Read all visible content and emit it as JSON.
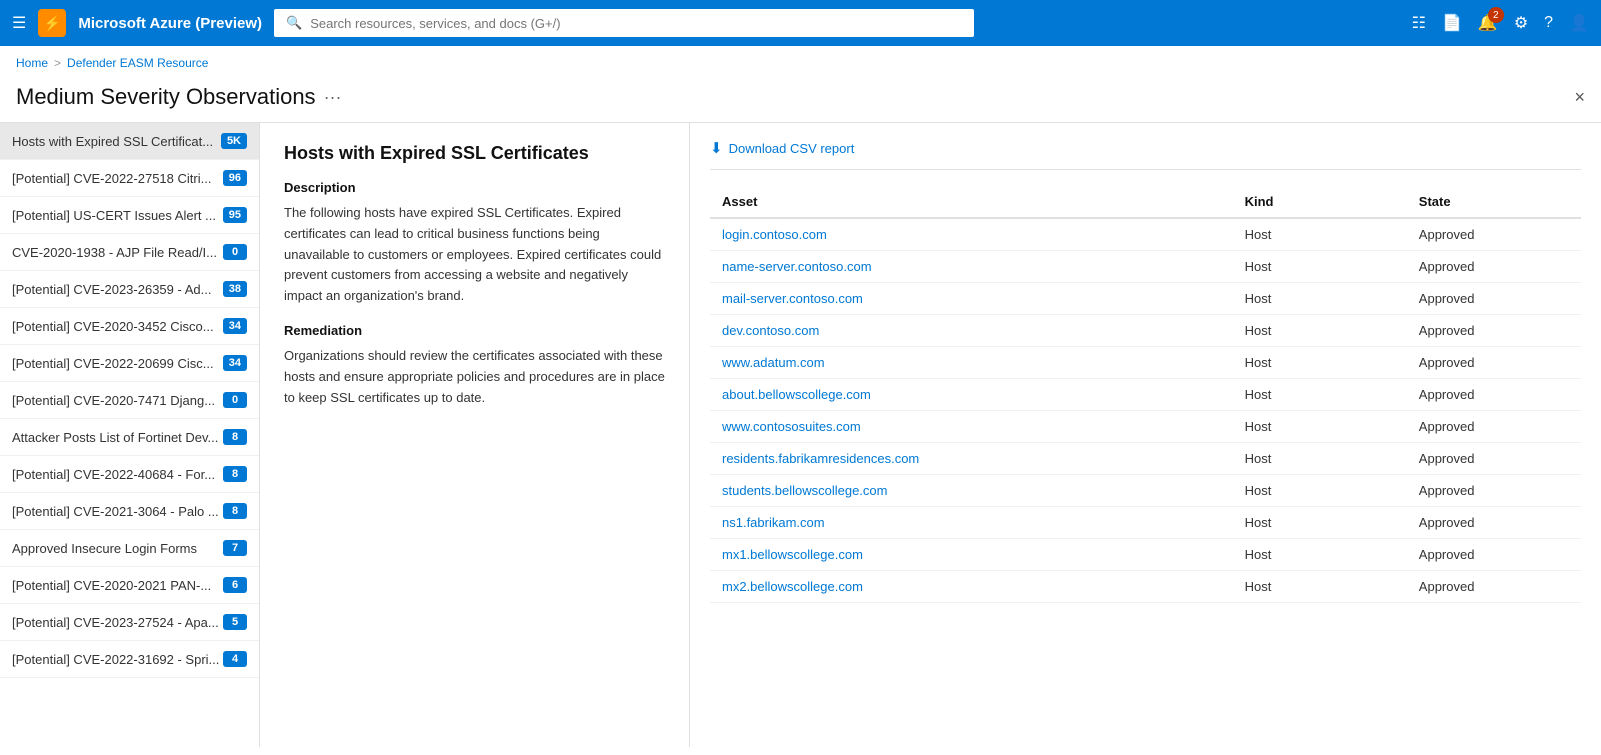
{
  "nav": {
    "brand": "Microsoft Azure (Preview)",
    "logo_char": "⚡",
    "search_placeholder": "Search resources, services, and docs (G+/)",
    "notification_count": "2",
    "icons": [
      "grid-icon",
      "portal-icon",
      "bell-icon",
      "gear-icon",
      "help-icon",
      "user-icon"
    ]
  },
  "breadcrumb": {
    "items": [
      "Home",
      "Defender EASM Resource"
    ]
  },
  "page": {
    "title": "Medium Severity Observations",
    "close_label": "×"
  },
  "sidebar": {
    "items": [
      {
        "label": "Hosts with Expired SSL Certificat...",
        "badge": "5K",
        "active": true
      },
      {
        "label": "[Potential] CVE-2022-27518 Citri...",
        "badge": "96"
      },
      {
        "label": "[Potential] US-CERT Issues Alert ...",
        "badge": "95"
      },
      {
        "label": "CVE-2020-1938 - AJP File Read/I...",
        "badge": "0"
      },
      {
        "label": "[Potential] CVE-2023-26359 - Ad...",
        "badge": "38"
      },
      {
        "label": "[Potential] CVE-2020-3452 Cisco...",
        "badge": "34"
      },
      {
        "label": "[Potential] CVE-2022-20699 Cisc...",
        "badge": "34"
      },
      {
        "label": "[Potential] CVE-2020-7471 Djang...",
        "badge": "0"
      },
      {
        "label": "Attacker Posts List of Fortinet Dev...",
        "badge": "8"
      },
      {
        "label": "[Potential] CVE-2022-40684 - For...",
        "badge": "8"
      },
      {
        "label": "[Potential] CVE-2021-3064 - Palo ...",
        "badge": "8"
      },
      {
        "label": "Approved Insecure Login Forms",
        "badge": "7"
      },
      {
        "label": "[Potential] CVE-2020-2021 PAN-...",
        "badge": "6"
      },
      {
        "label": "[Potential] CVE-2023-27524 - Apa...",
        "badge": "5"
      },
      {
        "label": "[Potential] CVE-2022-31692 - Spri...",
        "badge": "4"
      }
    ]
  },
  "detail": {
    "title": "Hosts with Expired SSL Certificates",
    "description_label": "Description",
    "description": "The following hosts have expired SSL Certificates. Expired certificates can lead to critical business functions being unavailable to customers or employees. Expired certificates could prevent customers from accessing a website and negatively impact an organization's brand.",
    "remediation_label": "Remediation",
    "remediation": "Organizations should review the certificates associated with these hosts and ensure appropriate policies and procedures are in place to keep SSL certificates up to date."
  },
  "table": {
    "csv_label": "Download CSV report",
    "columns": [
      "Asset",
      "Kind",
      "State"
    ],
    "rows": [
      {
        "asset": "login.contoso.com",
        "kind": "Host",
        "state": "Approved"
      },
      {
        "asset": "name-server.contoso.com",
        "kind": "Host",
        "state": "Approved"
      },
      {
        "asset": "mail-server.contoso.com",
        "kind": "Host",
        "state": "Approved"
      },
      {
        "asset": "dev.contoso.com",
        "kind": "Host",
        "state": "Approved"
      },
      {
        "asset": "www.adatum.com",
        "kind": "Host",
        "state": "Approved"
      },
      {
        "asset": "about.bellowscollege.com",
        "kind": "Host",
        "state": "Approved"
      },
      {
        "asset": "www.contososuites.com",
        "kind": "Host",
        "state": "Approved"
      },
      {
        "asset": "residents.fabrikamresidences.com",
        "kind": "Host",
        "state": "Approved"
      },
      {
        "asset": "students.bellowscollege.com",
        "kind": "Host",
        "state": "Approved"
      },
      {
        "asset": "ns1.fabrikam.com",
        "kind": "Host",
        "state": "Approved"
      },
      {
        "asset": "mx1.bellowscollege.com",
        "kind": "Host",
        "state": "Approved"
      },
      {
        "asset": "mx2.bellowscollege.com",
        "kind": "Host",
        "state": "Approved"
      }
    ]
  }
}
